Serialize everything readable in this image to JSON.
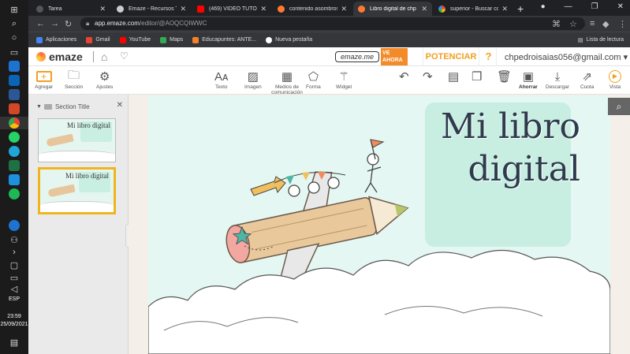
{
  "taskbar": {
    "lang": "ESP",
    "time": "23:59",
    "date": "25/09/2021"
  },
  "browser": {
    "tabs": [
      {
        "label": "Tarea",
        "color": "#3a3a3a"
      },
      {
        "label": "Emaze - Recursos Tl",
        "color": "#cccccc"
      },
      {
        "label": "(469) VIDEO TUTOR",
        "color": "#ff0000"
      },
      {
        "label": "contenido asombros",
        "color": "#ff7a30"
      },
      {
        "label": "Libro digital de chp",
        "color": "#ff7a30",
        "active": true
      },
      {
        "label": "superior - Buscar co",
        "color": "#4285f4"
      }
    ],
    "new_tab": "+",
    "url_host": "app.emaze.com",
    "url_path": "/editor/@AOQCQIWWC",
    "bookmarks": [
      {
        "label": "Aplicaciones",
        "color": "#4285f4"
      },
      {
        "label": "Gmail",
        "color": "#ea4335"
      },
      {
        "label": "YouTube",
        "color": "#ff0000"
      },
      {
        "label": "Maps",
        "color": "#34a853"
      },
      {
        "label": "Educapuntes: ANTE...",
        "color": "#f4812a"
      },
      {
        "label": "Nueva pestaña",
        "color": "#ffffff"
      }
    ],
    "reading_list": "Lista de lectura"
  },
  "app": {
    "brand": "emaze",
    "promo_tag": "emaze.me",
    "promo_ve": "VE AHORA",
    "potenciar": "POTENCIAR",
    "help": "?",
    "email": "chpedroisaias056@gmail.com ▾"
  },
  "toolbar": {
    "agregar": "Agregar",
    "seccion": "Sección",
    "ajustes": "Ajustes",
    "texto": "Texto",
    "imagen": "Imagen",
    "medios": "Medios de comunicación",
    "forma": "Forma",
    "widget": "Widget",
    "ahorrar": "Ahorrar",
    "descargar": "Descargar",
    "cuota": "Cuota",
    "vista": "Vista"
  },
  "panel": {
    "section_title": "Section Title",
    "slides": [
      {
        "title": "Mi libro digital"
      },
      {
        "title": "Mi libro digital"
      }
    ]
  },
  "slide": {
    "title": "Mi libro\ndigital"
  },
  "colors": {
    "accent": "#f0b51d",
    "slide_bg": "#e4f7f2",
    "title_box": "#c8eee2",
    "potenciar": "#f0a020"
  }
}
